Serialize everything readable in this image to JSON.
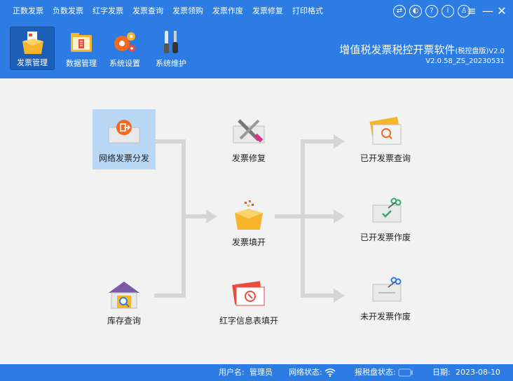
{
  "menu": {
    "items": [
      "正数发票",
      "负数发票",
      "红字发票",
      "发票查询",
      "发票领购",
      "发票作废",
      "发票修复",
      "打印格式"
    ]
  },
  "toolbar": {
    "items": [
      {
        "label": "发票管理",
        "icon": "invoice-box-icon",
        "active": true
      },
      {
        "label": "数据管理",
        "icon": "data-folder-icon"
      },
      {
        "label": "系统设置",
        "icon": "gears-icon"
      },
      {
        "label": "系统维护",
        "icon": "tools-icon"
      }
    ]
  },
  "app": {
    "title": "增值税发票税控开票软件",
    "edition": "(税控盘版)",
    "ver_short": "V2.0",
    "version": "V2.0.58_ZS_20230531"
  },
  "flow": {
    "nodes": {
      "network_distribute": "网络发票分发",
      "repair": "发票修复",
      "fill": "发票填开",
      "red_info": "红字信息表填开",
      "stock_query": "库存查询",
      "issued_query": "已开发票查询",
      "issued_void": "已开发票作废",
      "unissued_void": "未开发票作废"
    }
  },
  "status": {
    "user_label": "用户名:",
    "user": "管理员",
    "network_label": "网络状态:",
    "tax_disk_label": "报税盘状态:",
    "date_label": "日期:",
    "date": "2023-08-10"
  },
  "colors": {
    "primary": "#2d7ce4",
    "selected": "#b9d8f6",
    "connector": "#d6d6d6"
  }
}
